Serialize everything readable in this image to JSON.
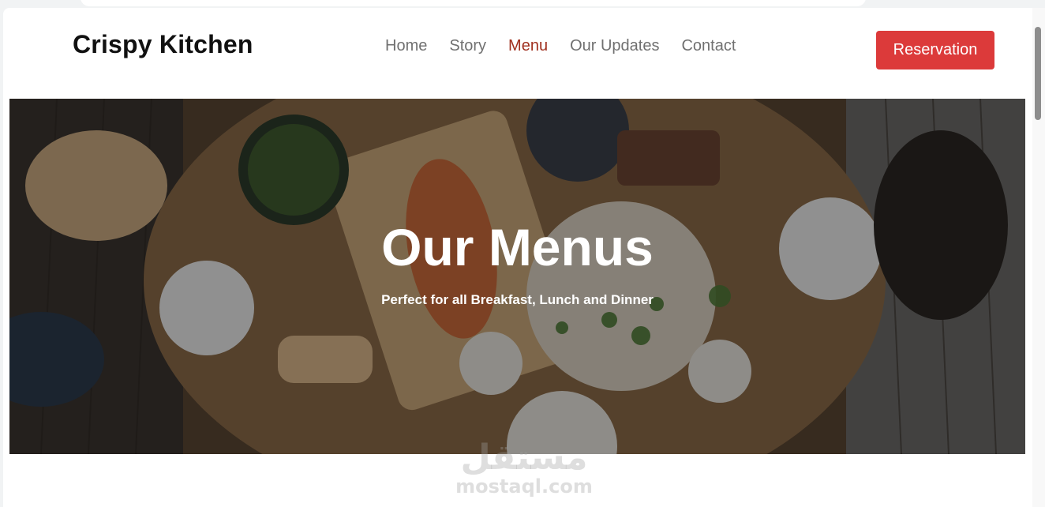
{
  "navbar": {
    "brand": "Crispy Kitchen",
    "links": [
      {
        "label": "Home",
        "active": false
      },
      {
        "label": "Story",
        "active": false
      },
      {
        "label": "Menu",
        "active": true
      },
      {
        "label": "Our Updates",
        "active": false
      },
      {
        "label": "Contact",
        "active": false
      }
    ],
    "cta_label": "Reservation"
  },
  "hero": {
    "title": "Our Menus",
    "subtitle": "Perfect for all Breakfast, Lunch and Dinner",
    "image": "overhead-dinner-table-photo"
  },
  "watermark": {
    "arabic": "مستقل",
    "latin": "mostaql.com"
  },
  "colors": {
    "accent_active_link": "#a0301f",
    "cta_background": "#dc3a3a",
    "nav_link": "#707070"
  }
}
